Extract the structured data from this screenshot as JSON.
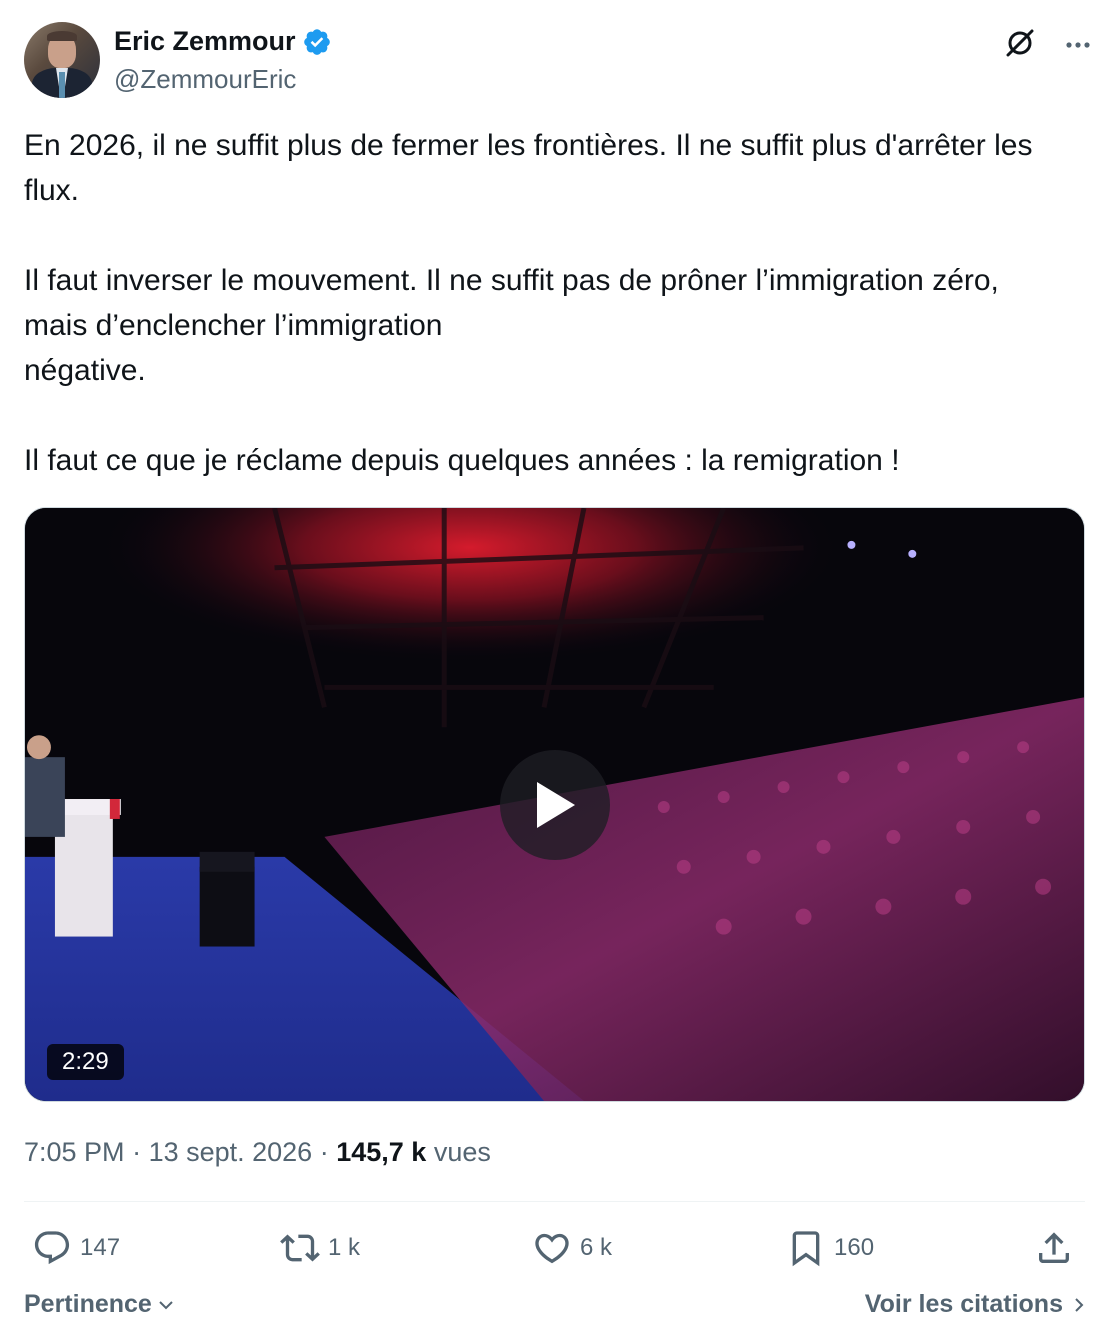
{
  "author": {
    "display_name": "Eric Zemmour",
    "handle": "@ZemmourEric",
    "verified": true,
    "avatar_icon": "profile-photo"
  },
  "tweet": {
    "paragraphs": [
      [
        "En 2026, il ne suffit plus de fermer les frontières. Il ne suffit plus d'arrêter les flux."
      ],
      [
        "Il faut inverser le mouvement. Il ne suffit pas de prôner l’immigration zéro, mais d’enclencher l’immigration",
        "négative."
      ],
      [
        "Il faut ce que je réclame depuis quelques années : la remigration !"
      ]
    ]
  },
  "media": {
    "type": "video",
    "duration": "2:29"
  },
  "meta": {
    "time": "7:05 PM",
    "separator": " · ",
    "date": "13 sept. 2026",
    "views_count": "145,7 k",
    "views_label": "vues"
  },
  "actions": {
    "replies": "147",
    "reposts": "1 k",
    "likes": "6 k",
    "bookmarks": "160"
  },
  "footer": {
    "sort_label": "Pertinence",
    "quotes_label": "Voir les citations"
  },
  "colors": {
    "text_primary": "#0f1419",
    "text_secondary": "#536471",
    "verified_blue": "#1d9bf0",
    "divider": "#eff3f4"
  }
}
